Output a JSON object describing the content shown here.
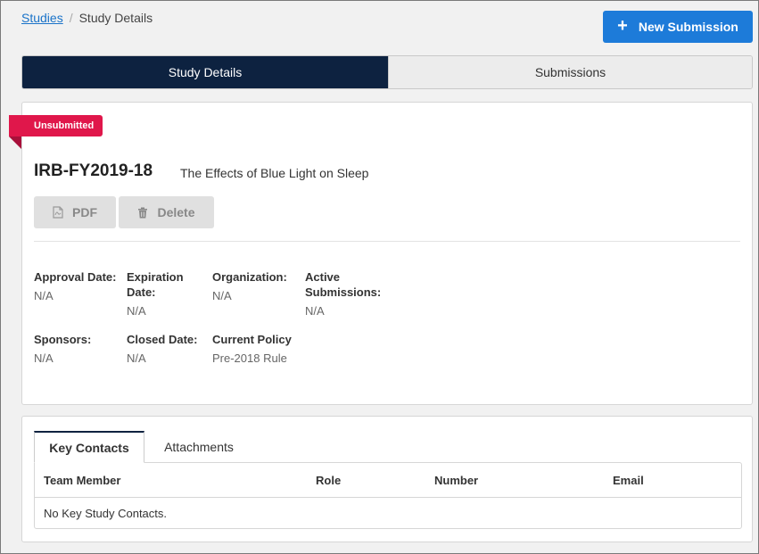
{
  "breadcrumb": {
    "root_label": "Studies",
    "separator": "/",
    "current_label": "Study Details"
  },
  "header": {
    "new_submission_label": "New Submission"
  },
  "main_tabs": [
    {
      "label": "Study Details",
      "active": true
    },
    {
      "label": "Submissions",
      "active": false
    }
  ],
  "study": {
    "status": "Unsubmitted",
    "id": "IRB-FY2019-18",
    "title": "The Effects of Blue Light on Sleep",
    "actions": {
      "pdf_label": "PDF",
      "delete_label": "Delete"
    },
    "fields": {
      "approval_date": {
        "label": "Approval Date:",
        "value": "N/A"
      },
      "expiration_date": {
        "label": "Expiration Date:",
        "value": "N/A"
      },
      "organization": {
        "label": "Organization:",
        "value": "N/A"
      },
      "active_submissions": {
        "label": "Active Submissions:",
        "value": "N/A"
      },
      "sponsors": {
        "label": "Sponsors:",
        "value": "N/A"
      },
      "closed_date": {
        "label": "Closed Date:",
        "value": "N/A"
      },
      "current_policy": {
        "label": "Current Policy",
        "value": "Pre-2018 Rule"
      }
    }
  },
  "contacts": {
    "tabs": [
      {
        "label": "Key Contacts",
        "active": true
      },
      {
        "label": "Attachments",
        "active": false
      }
    ],
    "columns": [
      "Team Member",
      "Role",
      "Number",
      "Email"
    ],
    "empty_message": "No Key Study Contacts."
  },
  "colors": {
    "primary": "#1d7bd9",
    "navy": "#0d2240",
    "status_red": "#e0174b"
  },
  "icons": {
    "new_submission": "plus-icon",
    "pdf": "pdf-file-icon",
    "delete": "trash-icon"
  }
}
